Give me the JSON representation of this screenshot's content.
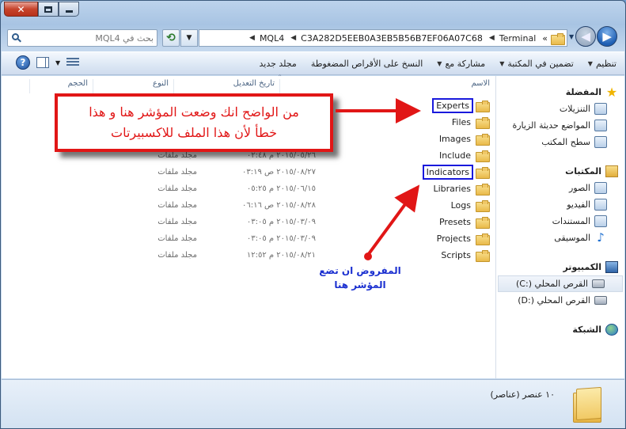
{
  "window": {
    "caption": {
      "close": "✕"
    },
    "search": {
      "placeholder": "بحث في MQL4"
    },
    "address": {
      "crumbs": [
        "Terminal",
        "C3A282D5EEB0A3EB5B56B7EF06A07C68",
        "MQL4"
      ],
      "more": "»"
    }
  },
  "toolbar": {
    "organize": "تنظيم",
    "include_in_library": "تضمين في المكتبة",
    "share_with": "مشاركة مع",
    "burn": "النسخ على الأقراص المضغوطة",
    "new_folder": "مجلد جديد",
    "help": "?"
  },
  "nav": {
    "favorites": {
      "title": "المفضلة",
      "items": [
        "التنزيلات",
        "المواضع حديثة الزيارة",
        "سطح المكتب"
      ]
    },
    "libraries": {
      "title": "المكتبات",
      "items": [
        "الصور",
        "الفيديو",
        "المستندات",
        "الموسيقى"
      ]
    },
    "computer": {
      "title": "الكمبيوتر",
      "items": [
        "القرص المحلي (:C)",
        "القرص المحلي (:D)"
      ]
    },
    "network": {
      "title": "الشبكة"
    }
  },
  "columns": {
    "name": "الاسم",
    "date": "تاريخ التعديل",
    "type": "النوع",
    "size": "الحجم"
  },
  "files": [
    {
      "name": "Experts",
      "date": "",
      "type": ""
    },
    {
      "name": "Files",
      "date": "",
      "type": ""
    },
    {
      "name": "Images",
      "date": "",
      "type": ""
    },
    {
      "name": "Include",
      "date": "٢٠١٥/٠٥/٢٦ م ٠٢:٤٨",
      "type": "مجلد ملفات"
    },
    {
      "name": "Indicators",
      "date": "٢٠١٥/٠٨/٢٧ ص ٠٣:١٩",
      "type": "مجلد ملفات"
    },
    {
      "name": "Libraries",
      "date": "٢٠١٥/٠٦/١٥ م ٠٥:٢٥",
      "type": "مجلد ملفات"
    },
    {
      "name": "Logs",
      "date": "٢٠١٥/٠٨/٢٨ ص ٠٦:١٦",
      "type": "مجلد ملفات"
    },
    {
      "name": "Presets",
      "date": "٢٠١٥/٠٣/٠٩ م ٠٣:٠٥",
      "type": "مجلد ملفات"
    },
    {
      "name": "Projects",
      "date": "٢٠١٥/٠٣/٠٩ م ٠٣:٠٥",
      "type": "مجلد ملفات"
    },
    {
      "name": "Scripts",
      "date": "٢٠١٥/٠٨/٢١ م ١٢:٥٢",
      "type": "مجلد ملفات"
    }
  ],
  "annotations": {
    "callout_line1": "من الواضح انك وضعت المؤشر هنا و هذا",
    "callout_line2": "خطأ لأن هذا الملف للاكسبيرتات",
    "note_line1": "المفروض ان تضع",
    "note_line2": "المؤشر هنا",
    "color": "#e11616",
    "note_color": "#1a2fd0"
  },
  "details": {
    "count": "١٠ عنصر (عناصر)"
  }
}
